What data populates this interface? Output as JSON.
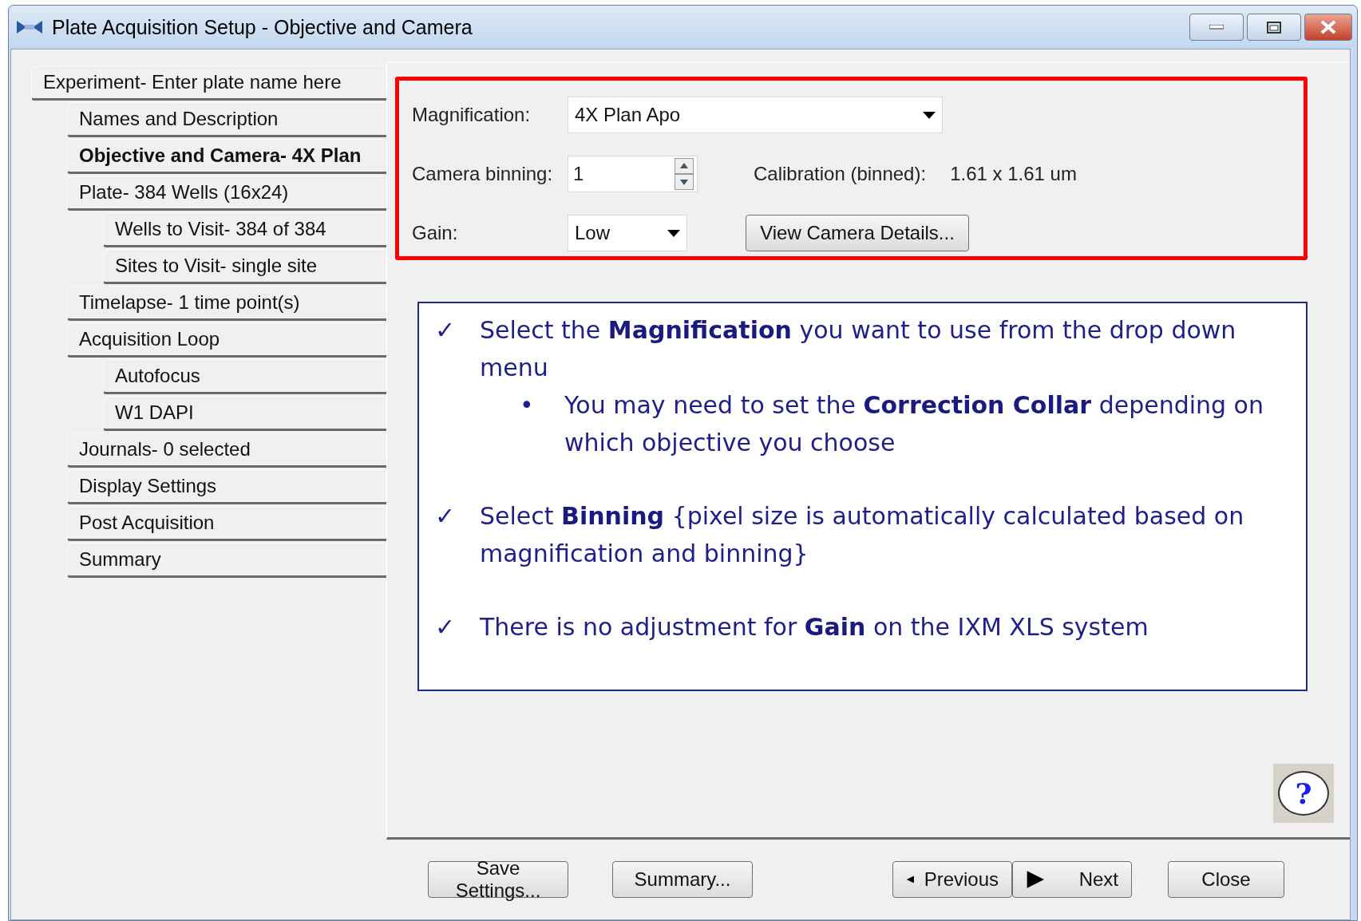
{
  "window": {
    "title": "Plate Acquisition Setup - Objective and Camera"
  },
  "tree": [
    {
      "label": "Experiment- Enter plate name here",
      "selected": false,
      "children": [
        {
          "label": "Names and Description",
          "selected": false
        },
        {
          "label": "Objective and Camera- 4X Plan",
          "selected": true
        },
        {
          "label": "Plate- 384 Wells (16x24)",
          "selected": false,
          "children": [
            {
              "label": "Wells to Visit- 384 of 384",
              "selected": false
            },
            {
              "label": "Sites to Visit- single site",
              "selected": false
            }
          ]
        },
        {
          "label": "Timelapse- 1 time point(s)",
          "selected": false
        },
        {
          "label": "Acquisition Loop",
          "selected": false,
          "children": [
            {
              "label": "Autofocus",
              "selected": false
            },
            {
              "label": "W1 DAPI",
              "selected": false
            }
          ]
        },
        {
          "label": "Journals- 0 selected",
          "selected": false
        },
        {
          "label": "Display Settings",
          "selected": false
        },
        {
          "label": "Post Acquisition",
          "selected": false
        },
        {
          "label": "Summary",
          "selected": false
        }
      ]
    }
  ],
  "settings": {
    "magnification": {
      "label": "Magnification:",
      "value": "4X Plan Apo"
    },
    "camera_binning": {
      "label": "Camera binning:",
      "value": "1"
    },
    "calibration": {
      "label": "Calibration (binned):",
      "value": "1.61 x 1.61 um"
    },
    "gain": {
      "label": "Gain:",
      "value": "Low"
    },
    "view_camera_details": "View Camera Details..."
  },
  "notes": [
    {
      "mark": "✓",
      "text": "Select the **Magnification** you want to use from the drop down menu",
      "children": [
        {
          "mark": "•",
          "text": "You may need to set the **Correction Collar** depending on which objective you choose"
        }
      ]
    },
    {
      "mark": "✓",
      "text": "Select **Binning** {pixel size is automatically calculated based on magnification and binning}"
    },
    {
      "mark": "✓",
      "text": "There is no adjustment for **Gain** on the IXM XLS system"
    }
  ],
  "help": {
    "glyph": "?"
  },
  "buttons": [
    {
      "label": "Save Settings...",
      "kind": "plain"
    },
    {
      "label": "Summary...",
      "kind": "plain"
    },
    {
      "label": "Previous",
      "kind": "previous"
    },
    {
      "label": "Next",
      "kind": "next"
    },
    {
      "label": "Close",
      "kind": "plain"
    }
  ]
}
